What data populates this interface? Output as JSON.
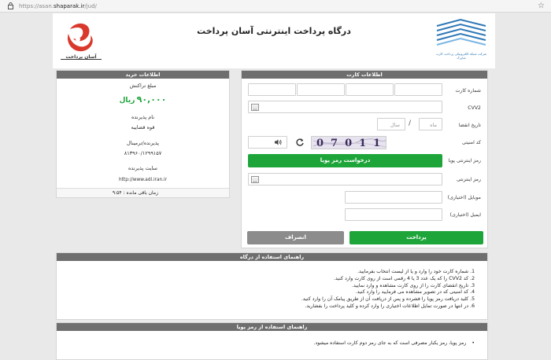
{
  "browser": {
    "url_prefix": "https://asan.",
    "url_domain": "shaparak.ir",
    "url_path": "/jud/"
  },
  "header": {
    "title": "درگاه پرداخت اینترنتی آسان پرداخت",
    "asan_logo_text": "آسان پرداخت",
    "shaparak_logo_text": "شرکت شبکه الکترونیکی پرداخت کارت شاپرک"
  },
  "purchase": {
    "heading": "اطلاعات خرید",
    "amount_label": "مبلغ تراکنش",
    "amount_value": "۹۰,۰۰۰",
    "amount_currency": "ریال",
    "merchant_label": "نام پذیرنده",
    "merchant_value": "قوه قضاییه",
    "terminal_label": "پذیرنده/ترمینال",
    "terminal_value": "۸۱۳۹۶۰/۱۲۹۹۱۵۷",
    "site_label": "سایت پذیرنده",
    "site_value": "http://www.adl.iran.ir",
    "timer_label": "زمان باقی مانده :",
    "timer_value": "۹:۵۴"
  },
  "card": {
    "heading": "اطلاعات کارت",
    "card_number_label": "شماره کارت",
    "cvv2_label": "CVV2",
    "expiry_label": "تاریخ انقضا",
    "month_placeholder": "ماه",
    "year_placeholder": "سال",
    "captcha_label": "کد امنیتی",
    "captcha_text": "07011",
    "otp_label": "رمز اینترنتی پویا",
    "otp_button": "درخواست رمز پویا",
    "password_label": "رمز اینترنتی",
    "mobile_label": "موبایل (اختیاری)",
    "email_label": "ایمیل (اختیاری)",
    "pay_button": "پرداخت",
    "cancel_button": "انصراف"
  },
  "guide": {
    "heading": "راهنمای استفاده از درگاه",
    "items": [
      "1. شماره کارت خود را وارد و یا از لیست انتخاب بفرمایید.",
      "2. کد CVV2 را که یک عدد 3 یا 4 رقمی است از روی کارت وارد کنید.",
      "3. تاریخ انقضای کارت را از روی کارت مشاهده و وارد نمایید.",
      "4. کد امنیتی که در تصویر مشاهده می فرمایید را وارد کنید.",
      "5. کلید دریافت رمز پویا را فشرده و پس از دریافت آن از طریق پیامک آن را وارد کنید.",
      "6. در انتها در صورت تمایل اطلاعات اختیاری را وارد کرده و کلید پرداخت را بفشارید."
    ]
  },
  "otp_guide": {
    "heading": "راهنمای استفاده از رمز پویا",
    "items": [
      "رمز پویا، رمز یکبار مصرفی است که به جای رمز دوم کارت استفاده میشود."
    ]
  },
  "colors": {
    "green": "#1ea53a",
    "header_gray": "#6e6e6e",
    "asan_red": "#d9392c",
    "shaparak_blue": "#2f78b7"
  }
}
